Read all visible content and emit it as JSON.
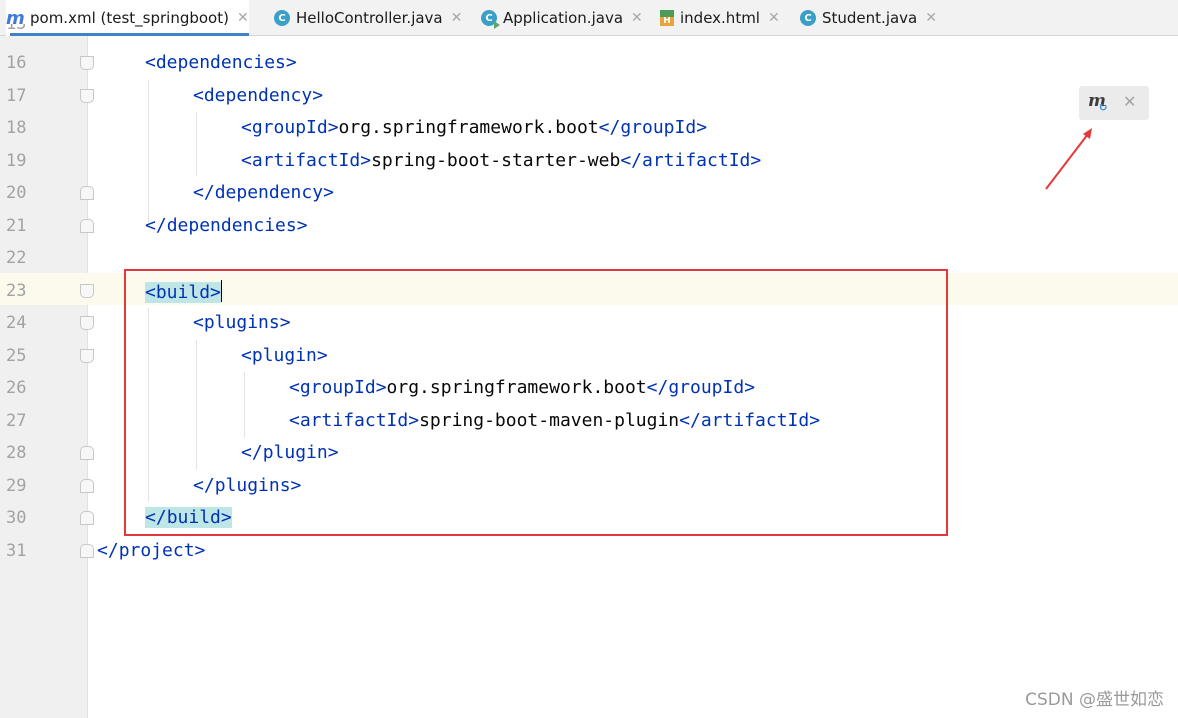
{
  "tabs": [
    {
      "label": "pom.xml (test_springboot)",
      "icon": "maven-icon",
      "active": true
    },
    {
      "label": "HelloController.java",
      "icon": "java-class-icon"
    },
    {
      "label": "Application.java",
      "icon": "java-runnable-class-icon"
    },
    {
      "label": "index.html",
      "icon": "html-file-icon"
    },
    {
      "label": "Student.java",
      "icon": "java-class-icon"
    }
  ],
  "line_numbers": [
    "16",
    "17",
    "18",
    "19",
    "20",
    "21",
    "22",
    "23",
    "24",
    "25",
    "26",
    "27",
    "28",
    "29",
    "30",
    "31"
  ],
  "code": {
    "l16_tag": "dependencies",
    "l17_tag": "dependency",
    "l18_tag": "groupId",
    "l18_value": "org.springframework.boot",
    "l19_tag": "artifactId",
    "l19_value": "spring-boot-starter-web",
    "l20_tag": "dependency",
    "l21_tag": "dependencies",
    "l23_tag": "build",
    "l24_tag": "plugins",
    "l25_tag": "plugin",
    "l26_tag": "groupId",
    "l26_value": "org.springframework.boot",
    "l27_tag": "artifactId",
    "l27_value": "spring-boot-maven-plugin",
    "l28_tag": "plugin",
    "l29_tag": "plugins",
    "l30_tag": "build",
    "l31_tag": "project"
  },
  "maven_popup": {
    "icon": "maven-reload-icon"
  },
  "watermark": "CSDN @盛世如恋",
  "colors": {
    "tag": "#0033b3",
    "highlight_box": "#e5383b",
    "tab_underline": "#4083c9"
  }
}
